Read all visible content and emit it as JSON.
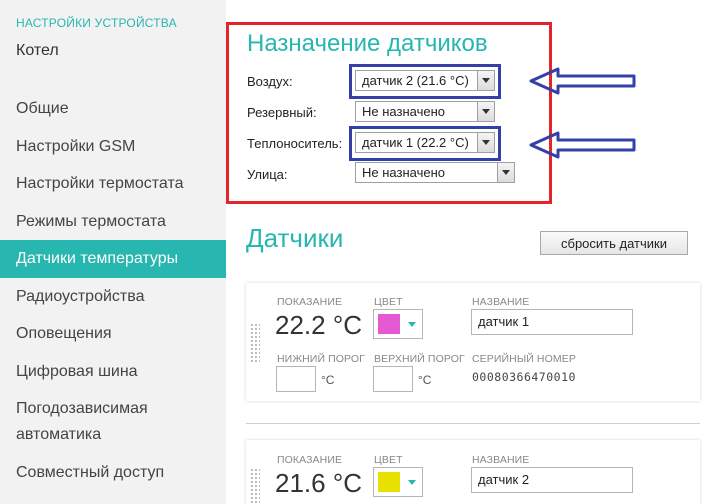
{
  "sidebar": {
    "heading": "НАСТРОЙКИ УСТРОЙСТВА",
    "device": "Котел",
    "items": [
      {
        "label": "Общие"
      },
      {
        "label": "Настройки GSM"
      },
      {
        "label": "Настройки термостата"
      },
      {
        "label": "Режимы термостата"
      },
      {
        "label": "Датчики температуры",
        "active": true
      },
      {
        "label": "Радиоустройства"
      },
      {
        "label": "Оповещения"
      },
      {
        "label": "Цифровая шина"
      },
      {
        "label": "Погодозависимая автоматика"
      },
      {
        "label": "Совместный доступ"
      }
    ]
  },
  "assignment": {
    "title": "Назначение датчиков",
    "rows": [
      {
        "label": "Воздух:",
        "value": "датчик 2 (21.6 °C)"
      },
      {
        "label": "Резервный:",
        "value": "Не назначено"
      },
      {
        "label": "Теплоноситель:",
        "value": "датчик 1 (22.2 °C)"
      },
      {
        "label": "Улица:",
        "value": "Не назначено"
      }
    ]
  },
  "sensors": {
    "title": "Датчики",
    "reset_label": "сбросить датчики",
    "labels": {
      "reading": "ПОКАЗАНИЕ",
      "color": "ЦВЕТ",
      "name": "НАЗВАНИЕ",
      "low": "НИЖНИЙ ПОРОГ",
      "high": "ВЕРХНИЙ ПОРОГ",
      "serial": "СЕРИЙНЫЙ НОМЕР",
      "unit": "°C"
    },
    "cards": [
      {
        "reading": "22.2 °C",
        "color": "#e55ad2",
        "name": "датчик 1",
        "serial": "00080366470010"
      },
      {
        "reading": "21.6 °C",
        "color": "#e8e000",
        "name": "датчик 2"
      }
    ]
  },
  "colors": {
    "accent": "#27b6b0",
    "annotation_red": "#e3242b",
    "annotation_blue": "#3340a8"
  }
}
